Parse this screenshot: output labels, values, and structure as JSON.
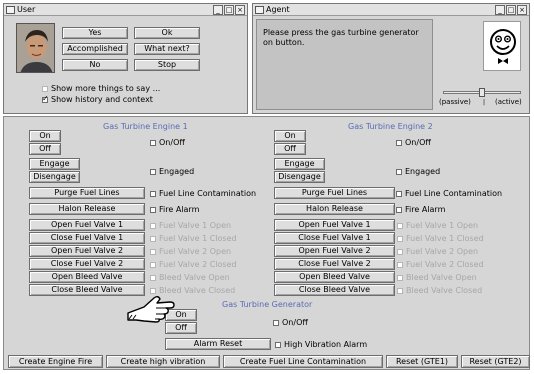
{
  "user_window": {
    "title": "User",
    "buttons": {
      "yes": "Yes",
      "ok": "Ok",
      "accomplished": "Accomplished",
      "what_next": "What next?",
      "no": "No",
      "stop": "Stop"
    },
    "show_more": "Show more things to say ...",
    "show_history": "Show history and context",
    "show_more_checked": false,
    "show_history_checked": true
  },
  "agent_window": {
    "title": "Agent",
    "message": "Please press the gas turbine generator on button.",
    "slider_passive": "(passive)",
    "slider_active": "(active)"
  },
  "engine1": {
    "title": "Gas Turbine Engine 1",
    "on": "On",
    "off": "Off",
    "onoff_label": "On/Off",
    "engage": "Engage",
    "disengage": "Disengage",
    "engaged_label": "Engaged",
    "purge": "Purge Fuel Lines",
    "purge_label": "Fuel Line Contamination",
    "halon": "Halon Release",
    "halon_label": "Fire Alarm",
    "valves": [
      {
        "btn": "Open Fuel Valve 1",
        "label": "Fuel Valve 1 Open"
      },
      {
        "btn": "Close Fuel Valve 1",
        "label": "Fuel Valve 1 Closed"
      },
      {
        "btn": "Open Fuel Valve 2",
        "label": "Fuel Valve 2 Open"
      },
      {
        "btn": "Close Fuel Valve 2",
        "label": "Fuel Valve 2 Closed"
      },
      {
        "btn": "Open Bleed Valve",
        "label": "Bleed Valve Open"
      },
      {
        "btn": "Close Bleed Valve",
        "label": "Bleed Valve Closed"
      }
    ]
  },
  "engine2": {
    "title": "Gas Turbine Engine 2",
    "on": "On",
    "off": "Off",
    "onoff_label": "On/Off",
    "engage": "Engage",
    "disengage": "Disengage",
    "engaged_label": "Engaged",
    "purge": "Purge Fuel Lines",
    "purge_label": "Fuel Line Contamination",
    "halon": "Halon Release",
    "halon_label": "Fire Alarm",
    "valves": [
      {
        "btn": "Open Fuel Valve 1",
        "label": "Fuel Valve 1 Open"
      },
      {
        "btn": "Close Fuel Valve 1",
        "label": "Fuel Valve 1 Closed"
      },
      {
        "btn": "Open Fuel Valve 2",
        "label": "Fuel Valve 2 Open"
      },
      {
        "btn": "Close Fuel Valve 2",
        "label": "Fuel Valve 2 Closed"
      },
      {
        "btn": "Open Bleed Valve",
        "label": "Bleed Valve Open"
      },
      {
        "btn": "Close Bleed Valve",
        "label": "Bleed Valve Closed"
      }
    ]
  },
  "generator": {
    "title": "Gas Turbine Generator",
    "on": "On",
    "off": "Off",
    "onoff_label": "On/Off",
    "alarm_reset": "Alarm Reset",
    "vibration_label": "High Vibration Alarm"
  },
  "bottom_bar": {
    "create_fire": "Create Engine Fire",
    "create_vibration": "Create high vibration",
    "create_contamination": "Create Fuel Line Contamination",
    "reset1": "Reset (GTE1)",
    "reset2": "Reset (GTE2)"
  },
  "colors": {
    "section_title": "#5a6cb5",
    "panel": "#d6d6d6",
    "agent_text_area": "#c3c3c3"
  }
}
